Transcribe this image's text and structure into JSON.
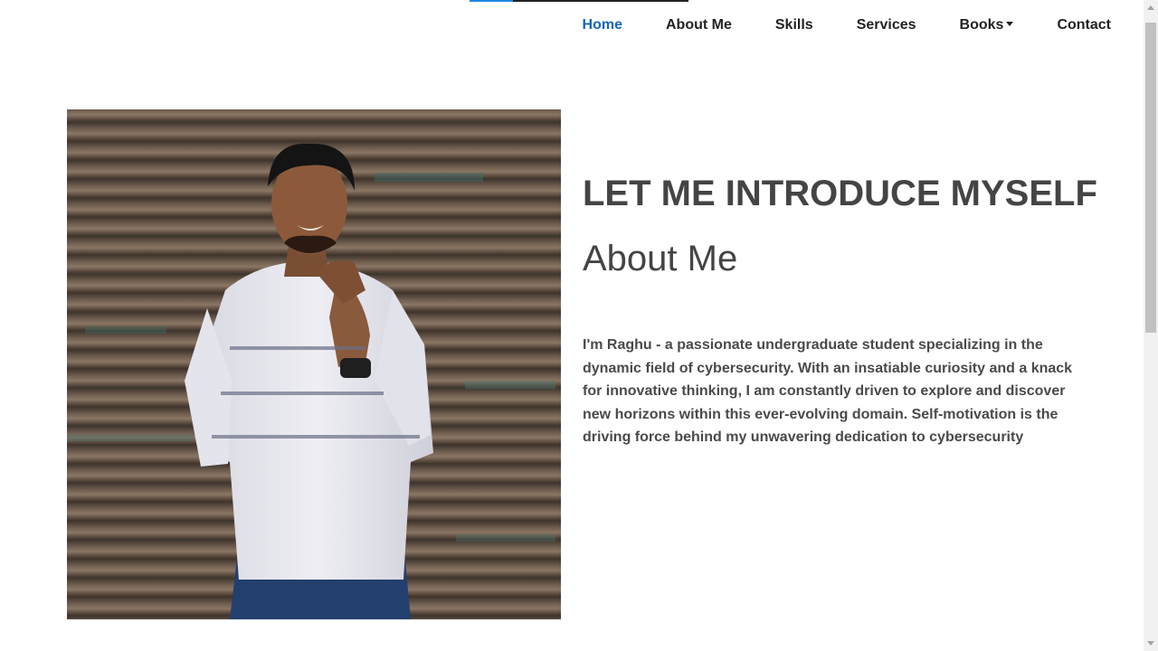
{
  "nav": {
    "items": [
      {
        "label": "Home",
        "active": true
      },
      {
        "label": "About Me"
      },
      {
        "label": "Skills"
      },
      {
        "label": "Services"
      },
      {
        "label": "Books",
        "dropdown": true
      },
      {
        "label": "Contact"
      }
    ]
  },
  "hero": {
    "photo_icon": "portrait-photo",
    "heading": "LET ME INTRODUCE MYSELF",
    "subheading": "About Me",
    "bio": "I'm Raghu - a passionate undergraduate student specializing in the dynamic field of cybersecurity. With an insatiable curiosity and a knack for innovative thinking, I am constantly driven to explore and discover new horizons within this ever-evolving domain. Self-motivation is the driving force behind my unwavering dedication to cybersecurity"
  },
  "colors": {
    "accent": "#1565c0",
    "text": "#444444",
    "progress": "#1e88e5"
  },
  "scroll_progress": 0.2
}
